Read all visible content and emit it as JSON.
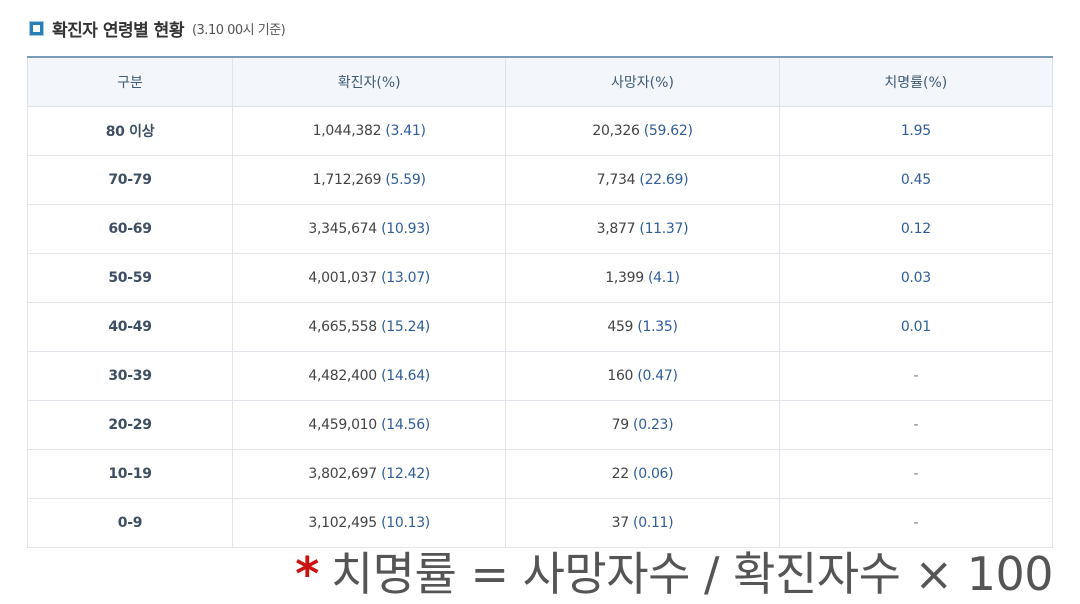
{
  "title": {
    "text": "확진자 연령별 현황",
    "sub": "(3.10 00시 기준)"
  },
  "table": {
    "headers": [
      "구분",
      "확진자(%)",
      "사망자(%)",
      "치명률(%)"
    ],
    "rows": [
      {
        "age": "80 이상",
        "cases": "1,044,382",
        "cases_pct": "(3.41)",
        "deaths": "20,326",
        "deaths_pct": "(59.62)",
        "fatality": "1.95"
      },
      {
        "age": "70-79",
        "cases": "1,712,269",
        "cases_pct": "(5.59)",
        "deaths": "7,734",
        "deaths_pct": "(22.69)",
        "fatality": "0.45"
      },
      {
        "age": "60-69",
        "cases": "3,345,674",
        "cases_pct": "(10.93)",
        "deaths": "3,877",
        "deaths_pct": "(11.37)",
        "fatality": "0.12"
      },
      {
        "age": "50-59",
        "cases": "4,001,037",
        "cases_pct": "(13.07)",
        "deaths": "1,399",
        "deaths_pct": "(4.1)",
        "fatality": "0.03"
      },
      {
        "age": "40-49",
        "cases": "4,665,558",
        "cases_pct": "(15.24)",
        "deaths": "459",
        "deaths_pct": "(1.35)",
        "fatality": "0.01"
      },
      {
        "age": "30-39",
        "cases": "4,482,400",
        "cases_pct": "(14.64)",
        "deaths": "160",
        "deaths_pct": "(0.47)",
        "fatality": "-"
      },
      {
        "age": "20-29",
        "cases": "4,459,010",
        "cases_pct": "(14.56)",
        "deaths": "79",
        "deaths_pct": "(0.23)",
        "fatality": "-"
      },
      {
        "age": "10-19",
        "cases": "3,802,697",
        "cases_pct": "(12.42)",
        "deaths": "22",
        "deaths_pct": "(0.06)",
        "fatality": "-"
      },
      {
        "age": "0-9",
        "cases": "3,102,495",
        "cases_pct": "(10.13)",
        "deaths": "37",
        "deaths_pct": "(0.11)",
        "fatality": "-"
      }
    ]
  },
  "formula": {
    "star": "*",
    "text": "치명률 = 사망자수 / 확진자수 × 100"
  },
  "colors": {
    "accent": "#2f5e9a",
    "header_bg": "#f3f7fb",
    "star": "#cc1111",
    "icon": "#2a7fb8"
  }
}
